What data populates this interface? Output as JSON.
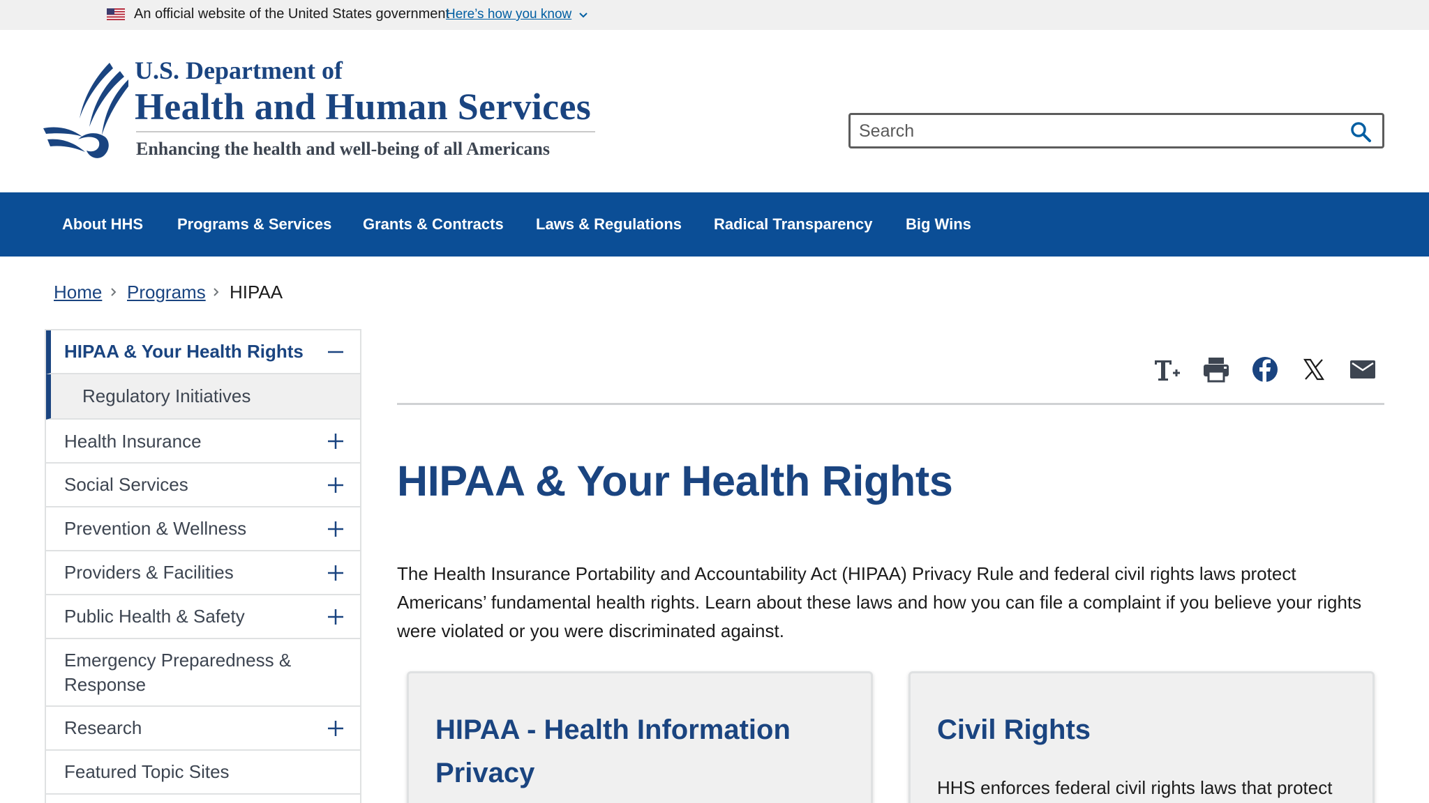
{
  "gov_banner": {
    "text": "An official website of the United States government",
    "link": "Here’s how you know"
  },
  "header": {
    "dept": "U.S. Department of",
    "agency": "Health and Human Services",
    "tagline": "Enhancing the health and well-being of all Americans",
    "search_placeholder": "Search"
  },
  "nav": {
    "items": [
      {
        "label": "About HHS"
      },
      {
        "label": "Programs & Services"
      },
      {
        "label": "Grants & Contracts"
      },
      {
        "label": "Laws & Regulations"
      },
      {
        "label": "Radical Transparency"
      },
      {
        "label": "Big Wins"
      }
    ]
  },
  "breadcrumb": {
    "items": [
      "Home",
      "Programs"
    ],
    "current": "HIPAA"
  },
  "sidenav": {
    "items": [
      {
        "label": "HIPAA & Your Health Rights",
        "state": "expanded"
      },
      {
        "label": "Regulatory Initiatives",
        "state": "sub"
      },
      {
        "label": "Health Insurance",
        "state": "collapsed"
      },
      {
        "label": "Social Services",
        "state": "collapsed"
      },
      {
        "label": "Prevention & Wellness",
        "state": "collapsed"
      },
      {
        "label": "Providers & Facilities",
        "state": "collapsed"
      },
      {
        "label": "Public Health & Safety",
        "state": "collapsed"
      },
      {
        "label": "Emergency Preparedness & Response",
        "state": "none"
      },
      {
        "label": "Research",
        "state": "collapsed"
      },
      {
        "label": "Featured Topic Sites",
        "state": "none"
      }
    ]
  },
  "tools": [
    "text-size-icon",
    "print-icon",
    "facebook-icon",
    "x-icon",
    "email-icon"
  ],
  "content": {
    "title": "HIPAA & Your Health Rights",
    "intro": "The Health Insurance Portability and Accountability Act (HIPAA) Privacy Rule and federal civil rights laws protect Americans’ fundamental health rights. Learn about these laws and how you can file a complaint if you believe your rights were violated or you were discriminated against.",
    "cards": [
      {
        "title": "HIPAA - Health Information Privacy",
        "body": ""
      },
      {
        "title": "Civil Rights",
        "body": "HHS enforces federal civil rights laws that protect"
      }
    ]
  },
  "colors": {
    "brand_blue": "#1a4480",
    "nav_blue": "#0b4e96",
    "link_blue": "#005ea2"
  }
}
